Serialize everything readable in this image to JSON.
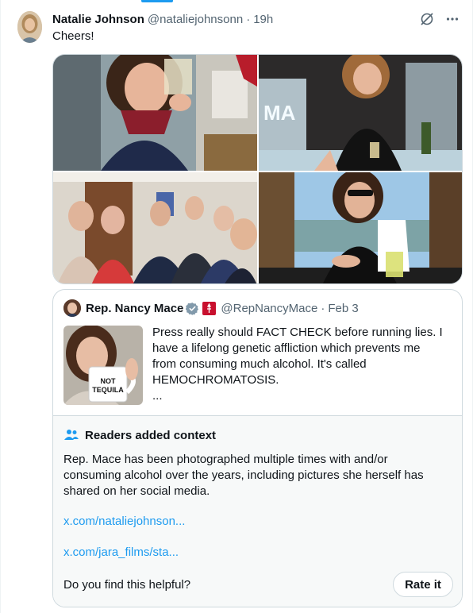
{
  "tweet": {
    "author_name": "Natalie Johnson",
    "author_handle": "@nataliejohnsonn",
    "separator": "·",
    "time": "19h",
    "text": "Cheers!",
    "grok_icon": "grok-icon",
    "more_icon": "more-icon"
  },
  "media": {
    "photos": [
      "photo-woman-raising-glass",
      "photo-woman-ice-sculpture",
      "photo-group-office-toast",
      "photo-woman-marina-drink"
    ],
    "visible_sign_text": "MA"
  },
  "quote": {
    "author_name": "Rep. Nancy Mace",
    "author_handle": "@RepNancyMace",
    "separator": "·",
    "date": "Feb 3",
    "verified_icon": "gov-verified-icon",
    "flag_icon": "congress-flag-icon",
    "text_line1": "Press really should FACT CHECK before running lies. I",
    "text_line2": "have a lifelong genetic affliction which prevents me",
    "text_line3": "from consuming much alcohol. It's called",
    "text_line4": "HEMOCHROMATOSIS.",
    "text_line5": "...",
    "mug_text_line1": "NOT",
    "mug_text_line2": "TEQUILA"
  },
  "context": {
    "title": "Readers added context",
    "icon": "people-icon",
    "body_line1": "Rep. Mace has been photographed multiple times with and/or",
    "body_line2": "consuming alcohol over the years, including pictures she herself has",
    "body_line3": "shared on her social media.",
    "link1": "x.com/nataliejohnson...",
    "link2": "x.com/jara_films/sta...",
    "question": "Do you find this helpful?",
    "rate_button": "Rate it"
  },
  "colors": {
    "link": "#1d9bf0",
    "secondary_text": "#536471",
    "border": "#cfd9de",
    "context_bg": "#f7f9f9",
    "verified_gray": "#829aab",
    "flag_red": "#c8102e"
  }
}
